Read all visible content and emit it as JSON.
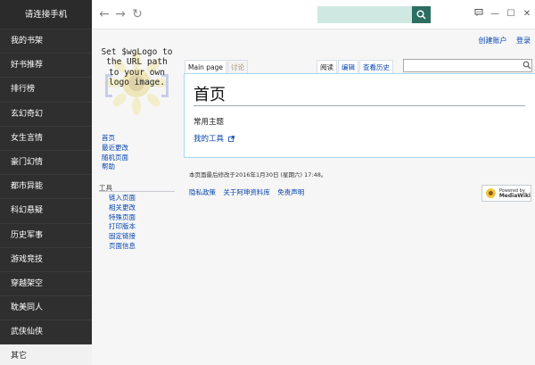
{
  "sidebar": {
    "connect_label": "请连接手机",
    "items": [
      {
        "label": "我的书架"
      },
      {
        "label": "好书推荐"
      },
      {
        "label": "排行榜"
      },
      {
        "label": "玄幻奇幻"
      },
      {
        "label": "女生言情"
      },
      {
        "label": "豪门幻情"
      },
      {
        "label": "都市异能"
      },
      {
        "label": "科幻悬疑"
      },
      {
        "label": "历史军事"
      },
      {
        "label": "游戏竞技"
      },
      {
        "label": "穿越架空"
      },
      {
        "label": "耽美同人"
      },
      {
        "label": "武侠仙侠"
      },
      {
        "label": "其它"
      }
    ],
    "active_index": 13
  },
  "topbar": {
    "back_icon": "←",
    "forward_icon": "→",
    "reload_icon": "↻",
    "search_value": "",
    "search_icon": "search-icon",
    "chat_icon": "chat-icon",
    "minimize_icon": "—",
    "maximize_icon": "☐",
    "close_icon": "✕",
    "search_button_color": "#2d6e62",
    "search_bg_color": "#cfe8e2"
  },
  "wiki": {
    "user_links": {
      "create_account": "创建账户",
      "login": "登录"
    },
    "logo_text": "Set $wgLogo to the URL path to your own logo image.",
    "tabs_left": [
      {
        "label": "Main page"
      },
      {
        "label": "讨论"
      }
    ],
    "tabs_right": [
      {
        "label": "阅读"
      },
      {
        "label": "编辑"
      },
      {
        "label": "查看历史"
      }
    ],
    "search_value": "",
    "page_title": "首页",
    "page_subtitle": "常用主题",
    "page_link": "我的工具",
    "nav_links": [
      {
        "label": "首页"
      },
      {
        "label": "最近更改"
      },
      {
        "label": "随机页面"
      },
      {
        "label": "帮助"
      }
    ],
    "tools_heading": "工具",
    "tools_links": [
      {
        "label": "链入页面"
      },
      {
        "label": "相关更改"
      },
      {
        "label": "特殊页面"
      },
      {
        "label": "打印版本"
      },
      {
        "label": "固定链接"
      },
      {
        "label": "页面信息"
      }
    ],
    "footer_modified": "本页面最后修改于2016年1月30日 (星期六) 17:48。",
    "footer_links": [
      {
        "label": "隐私政策"
      },
      {
        "label": "关于阿坤资料库"
      },
      {
        "label": "免责声明"
      }
    ],
    "mw_badge_line1": "Powered by",
    "mw_badge_line2": "MediaWiki",
    "link_color": "#0645ad"
  }
}
